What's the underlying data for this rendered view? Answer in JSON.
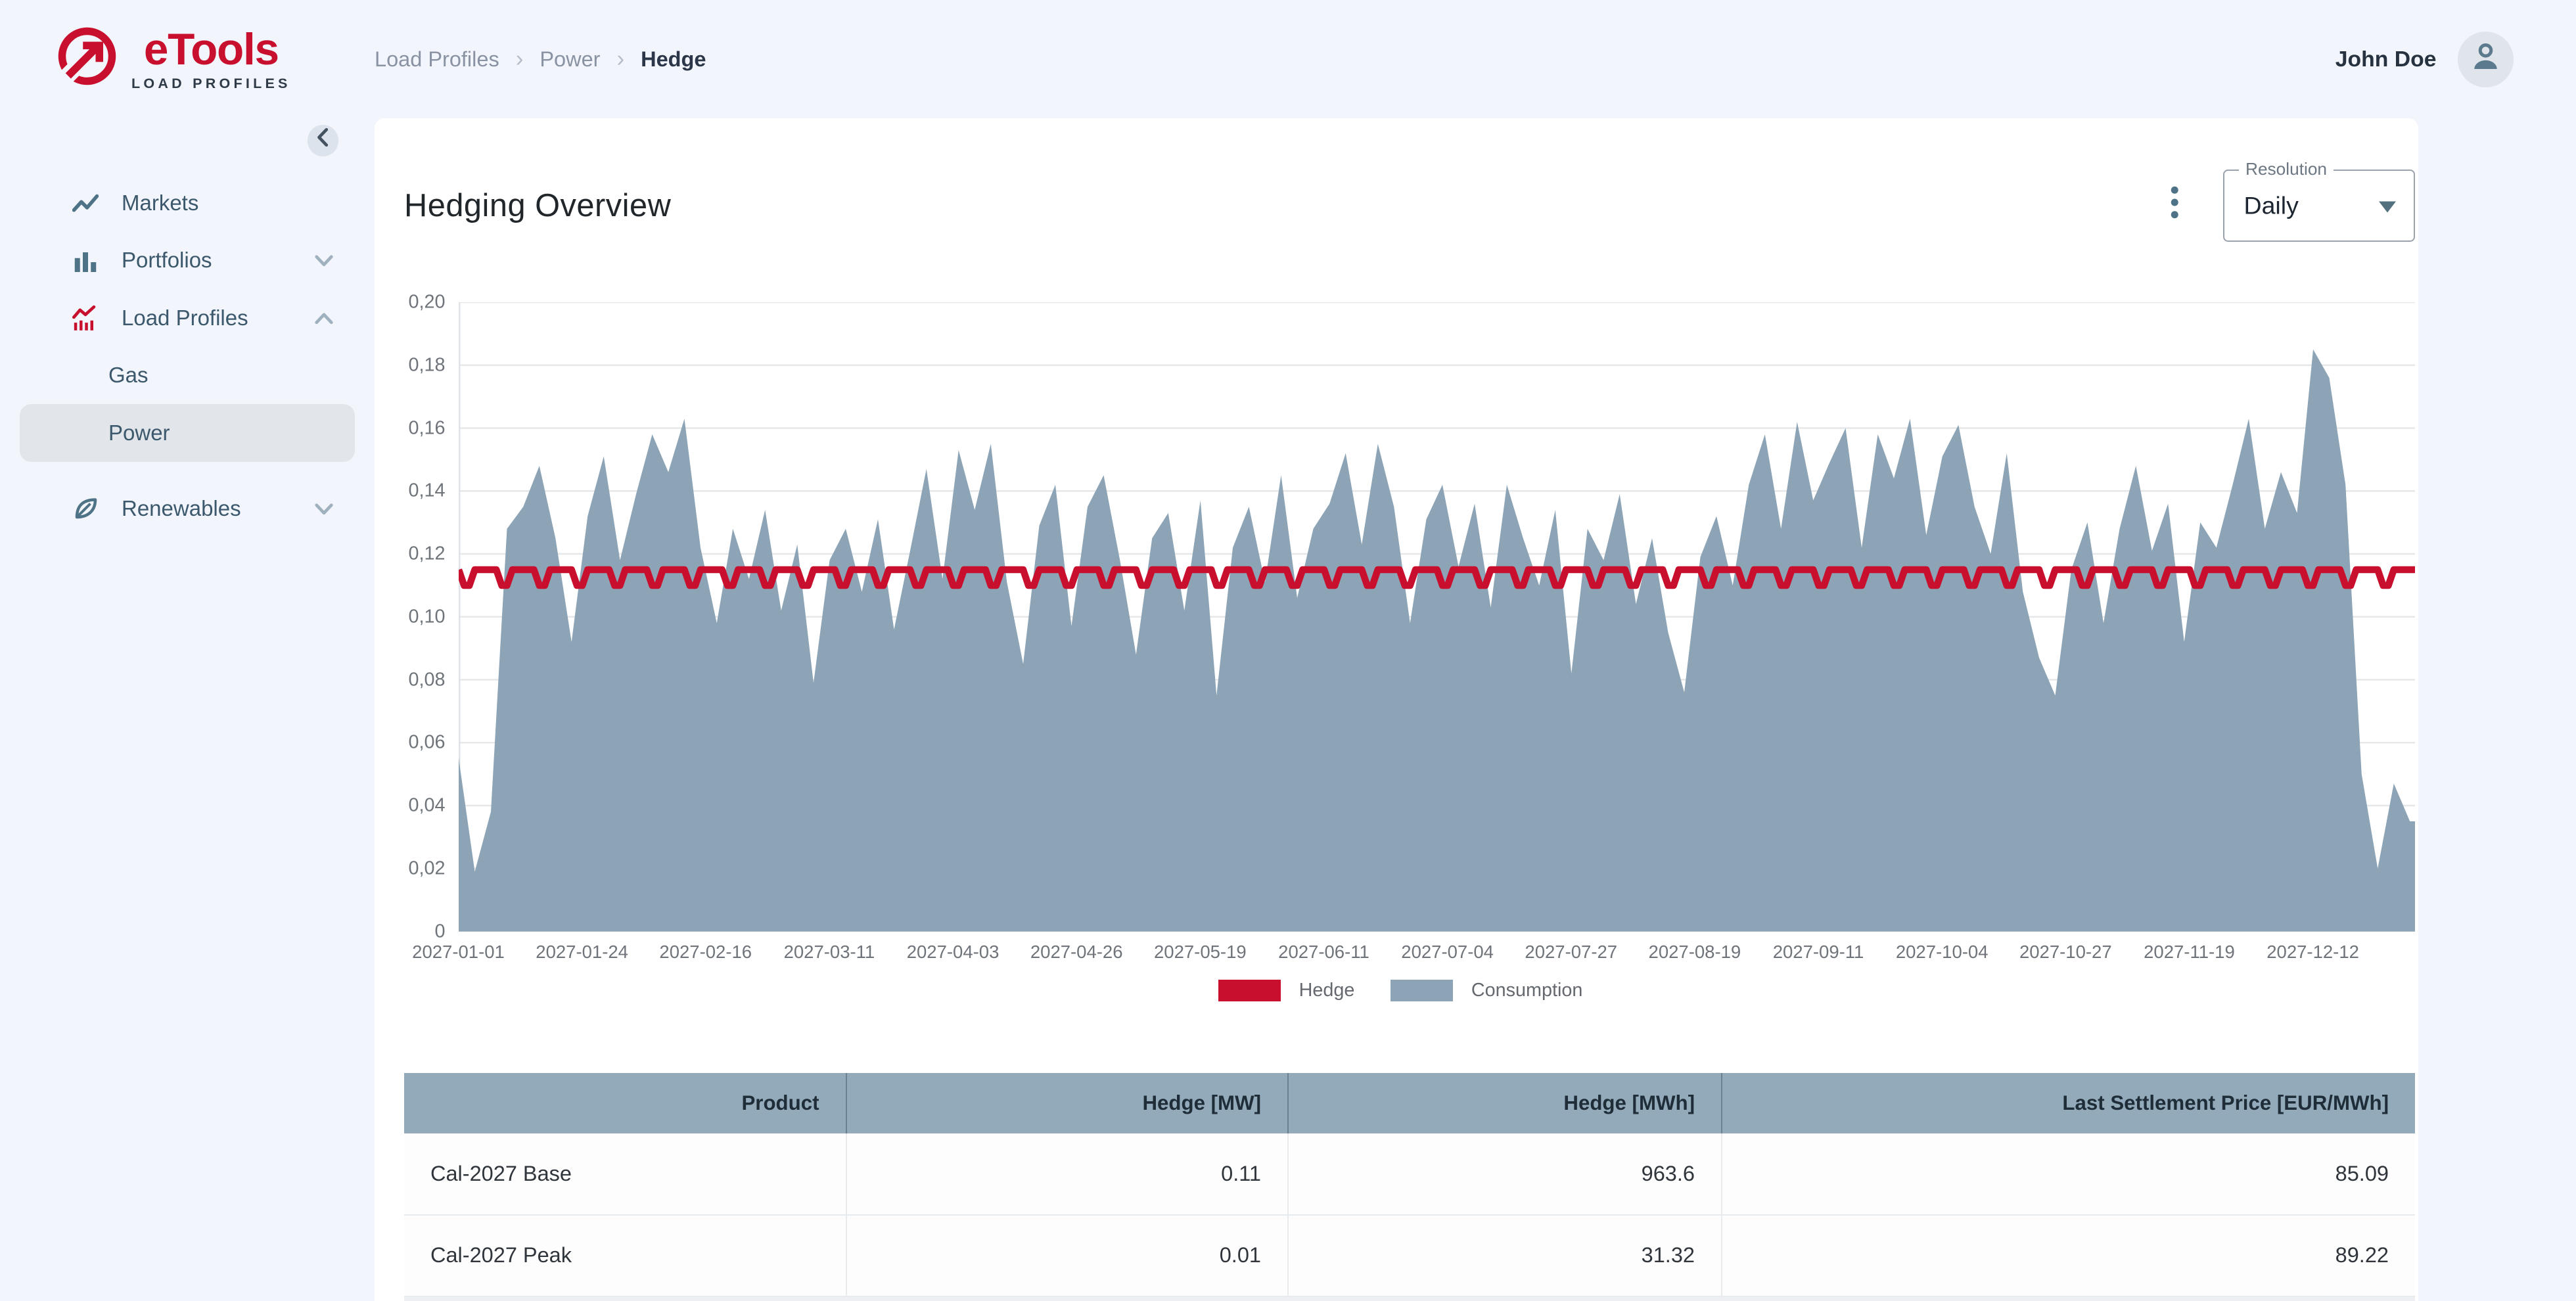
{
  "brand": {
    "name": "eTools",
    "subtitle": "LOAD PROFILES"
  },
  "header": {
    "breadcrumb": [
      "Load Profiles",
      "Power",
      "Hedge"
    ],
    "breadcrumb_separator": "›",
    "user_name": "John Doe"
  },
  "sidebar": {
    "items": [
      {
        "label": "Markets"
      },
      {
        "label": "Portfolios"
      },
      {
        "label": "Load Profiles"
      },
      {
        "label": "Gas"
      },
      {
        "label": "Power"
      },
      {
        "label": "Renewables"
      }
    ]
  },
  "panel": {
    "title": "Hedging Overview",
    "resolution_label": "Resolution",
    "resolution_value": "Daily"
  },
  "chart_data": {
    "type": "area",
    "title": "Hedging Overview",
    "xlabel": "",
    "ylabel": "",
    "ylim": [
      0,
      0.2
    ],
    "y_tick_labels": [
      "0",
      "0,02",
      "0,04",
      "0,06",
      "0,08",
      "0,10",
      "0,12",
      "0,14",
      "0,16",
      "0,18",
      "0,20"
    ],
    "x_start_date": "2027-01-01",
    "x_total_days": 365,
    "x_tick_interval_days": 23,
    "x_tick_labels": [
      "2027-01-01",
      "2027-01-24",
      "2027-02-16",
      "2027-03-11",
      "2027-04-03",
      "2027-04-26",
      "2027-05-19",
      "2027-06-11",
      "2027-07-04",
      "2027-07-27",
      "2027-08-19",
      "2027-09-11",
      "2027-10-04",
      "2027-10-27",
      "2027-11-19",
      "2027-12-12"
    ],
    "grid": "horizontal",
    "legend_position": "bottom-center",
    "series": [
      {
        "name": "Hedge",
        "type": "line",
        "color": "#C8102E",
        "unit": "MW",
        "pattern": {
          "weekday_value": 0.115,
          "weekend_value": 0.11,
          "start_day_of_week": "Friday"
        }
      },
      {
        "name": "Consumption",
        "type": "area",
        "color": "#8CA4B5",
        "unit": "MW",
        "sample_step_days": 3,
        "values": [
          0.055,
          0.019,
          0.038,
          0.128,
          0.135,
          0.148,
          0.125,
          0.092,
          0.132,
          0.151,
          0.118,
          0.139,
          0.158,
          0.146,
          0.163,
          0.122,
          0.098,
          0.128,
          0.112,
          0.134,
          0.102,
          0.123,
          0.079,
          0.118,
          0.128,
          0.108,
          0.131,
          0.096,
          0.121,
          0.147,
          0.112,
          0.153,
          0.134,
          0.155,
          0.111,
          0.085,
          0.129,
          0.142,
          0.097,
          0.135,
          0.145,
          0.118,
          0.088,
          0.125,
          0.133,
          0.102,
          0.137,
          0.075,
          0.122,
          0.135,
          0.111,
          0.145,
          0.106,
          0.128,
          0.136,
          0.152,
          0.123,
          0.155,
          0.135,
          0.098,
          0.131,
          0.142,
          0.116,
          0.136,
          0.103,
          0.142,
          0.125,
          0.11,
          0.134,
          0.082,
          0.128,
          0.118,
          0.139,
          0.104,
          0.125,
          0.095,
          0.076,
          0.119,
          0.132,
          0.11,
          0.142,
          0.158,
          0.128,
          0.162,
          0.137,
          0.149,
          0.16,
          0.122,
          0.158,
          0.144,
          0.163,
          0.126,
          0.151,
          0.161,
          0.135,
          0.12,
          0.152,
          0.108,
          0.087,
          0.075,
          0.115,
          0.13,
          0.098,
          0.128,
          0.148,
          0.121,
          0.136,
          0.092,
          0.13,
          0.122,
          0.142,
          0.163,
          0.128,
          0.146,
          0.133,
          0.185,
          0.176,
          0.142,
          0.05,
          0.02,
          0.047,
          0.035
        ]
      }
    ]
  },
  "table": {
    "columns": [
      "Product",
      "Hedge [MW]",
      "Hedge [MWh]",
      "Last Settlement Price [EUR/MWh]"
    ],
    "rows": [
      [
        "Cal-2027 Base",
        "0.11",
        "963.6",
        "85.09"
      ],
      [
        "Cal-2027 Peak",
        "0.01",
        "31.32",
        "89.22"
      ]
    ]
  }
}
